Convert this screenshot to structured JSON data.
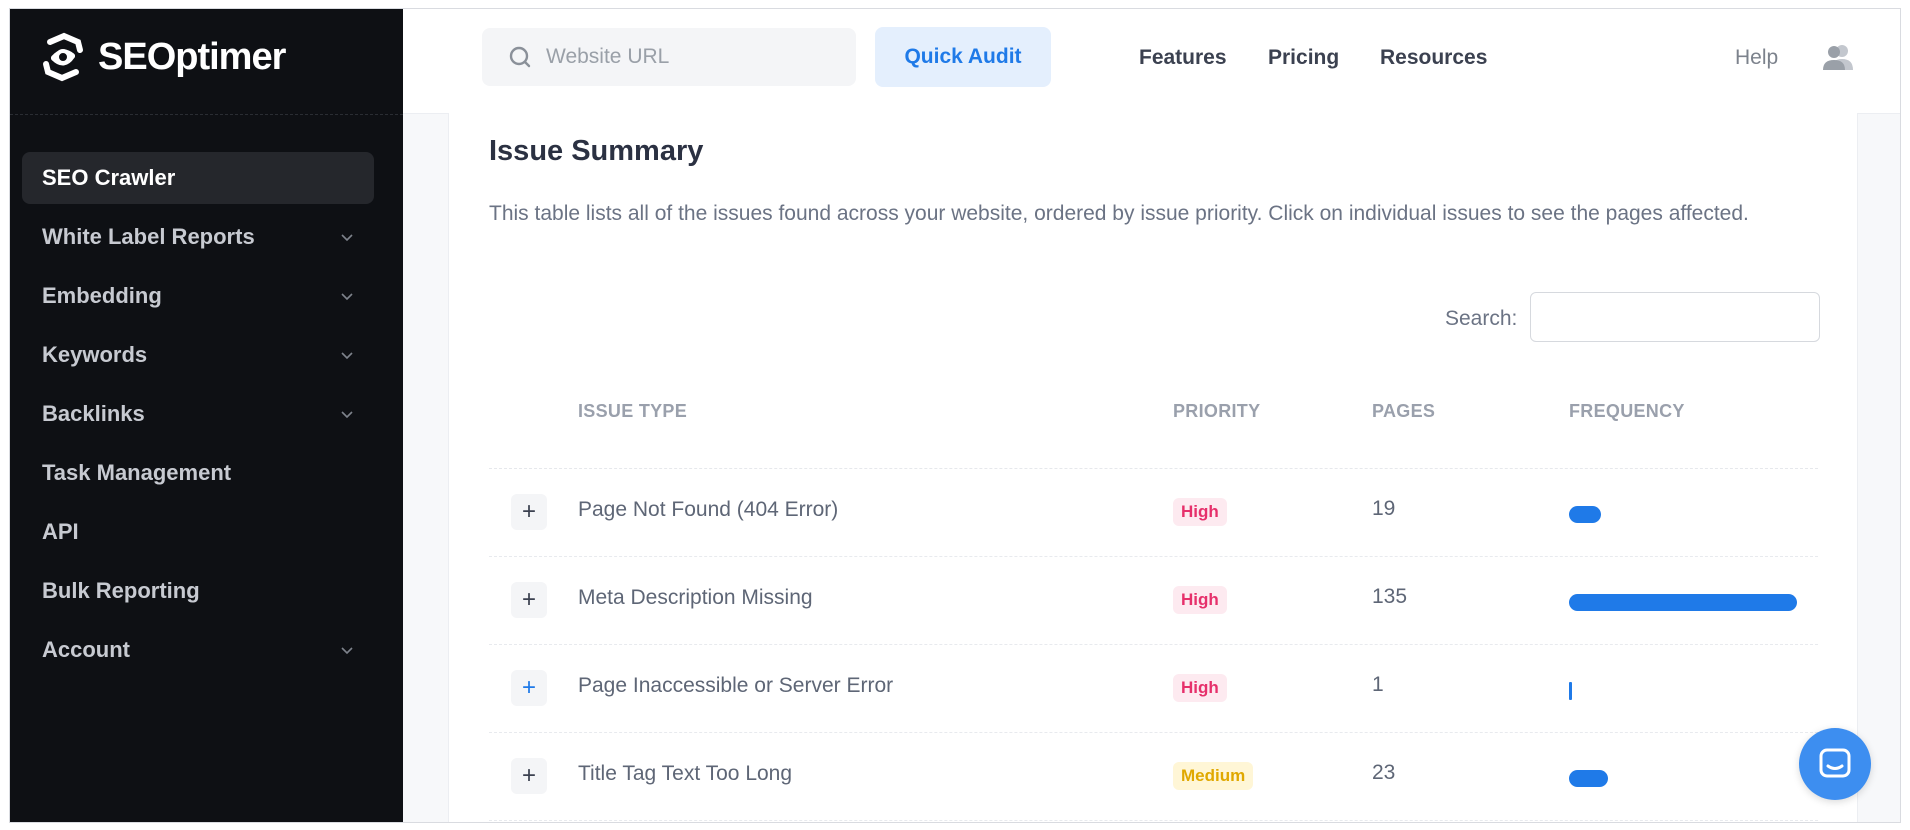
{
  "brand": {
    "name": "SEOptimer"
  },
  "sidebar": {
    "items": [
      {
        "label": "SEO Crawler",
        "active": true,
        "has_chevron": false
      },
      {
        "label": "White Label Reports",
        "active": false,
        "has_chevron": true
      },
      {
        "label": "Embedding",
        "active": false,
        "has_chevron": true
      },
      {
        "label": "Keywords",
        "active": false,
        "has_chevron": true
      },
      {
        "label": "Backlinks",
        "active": false,
        "has_chevron": true
      },
      {
        "label": "Task Management",
        "active": false,
        "has_chevron": false
      },
      {
        "label": "API",
        "active": false,
        "has_chevron": false
      },
      {
        "label": "Bulk Reporting",
        "active": false,
        "has_chevron": false
      },
      {
        "label": "Account",
        "active": false,
        "has_chevron": true
      }
    ]
  },
  "header": {
    "url_placeholder": "Website URL",
    "quick_audit_label": "Quick Audit",
    "links": [
      "Features",
      "Pricing",
      "Resources"
    ],
    "help_label": "Help"
  },
  "main": {
    "title": "Issue Summary",
    "description": "This table lists all of the issues found across your website, ordered by issue priority. Click on individual issues to see the pages affected.",
    "search_label": "Search:",
    "columns": [
      "ISSUE TYPE",
      "PRIORITY",
      "PAGES",
      "FREQUENCY"
    ],
    "rows": [
      {
        "expand": "+",
        "issue": "Page Not Found (404 Error)",
        "priority": "High",
        "pages": "19",
        "frequency": 0.14
      },
      {
        "expand": "+",
        "issue": "Meta Description Missing",
        "priority": "High",
        "pages": "135",
        "frequency": 1.0
      },
      {
        "expand": "+",
        "issue": "Page Inaccessible or Server Error",
        "priority": "High",
        "pages": "1",
        "frequency": 0.007
      },
      {
        "expand": "+",
        "issue": "Title Tag Text Too Long",
        "priority": "Medium",
        "pages": "23",
        "frequency": 0.17
      }
    ]
  },
  "colors": {
    "accent": "#1f7ae8",
    "sidebar_bg": "#0e1014",
    "high_badge": "#e6306b",
    "medium_badge": "#e0a800"
  },
  "icons": {
    "search": "search-icon",
    "user": "user-icon",
    "chat": "chat-icon",
    "chevron": "chevron-down-icon"
  }
}
